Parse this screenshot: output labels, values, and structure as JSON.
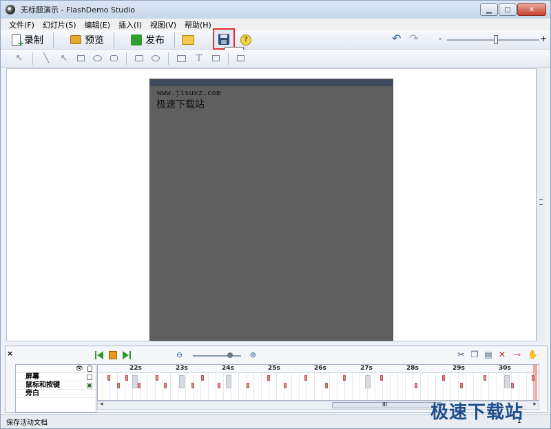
{
  "window": {
    "title": "无标题演示 - FlashDemo Studio",
    "controls": {
      "minimize": "▁",
      "maximize": "□",
      "close": "✕"
    }
  },
  "menu": [
    "文件(F)",
    "幻灯片(S)",
    "编辑(E)",
    "插入(I)",
    "视图(V)",
    "帮助(H)"
  ],
  "toolbar": {
    "record_label": "录制",
    "preview_label": "预览",
    "publish_label": "发布",
    "save_tooltip": "保存",
    "help_icon": "?",
    "zoom_minus": "-",
    "zoom_plus": "+"
  },
  "slide": {
    "url": "www.jisuxz.com",
    "site_name": "极速下载站"
  },
  "timeline": {
    "close": "×",
    "ticks": [
      "22s",
      "23s",
      "24s",
      "25s",
      "26s",
      "27s",
      "28s",
      "29s",
      "30s"
    ],
    "layers": [
      {
        "name": "屏幕",
        "checked": false
      },
      {
        "name": "鼠标和按键",
        "checked": true
      },
      {
        "name": "旁白",
        "checked": false
      }
    ],
    "scroll_grip": "III"
  },
  "status": {
    "text": "保存活动文档",
    "number": "1"
  },
  "watermark": "极速下载站"
}
